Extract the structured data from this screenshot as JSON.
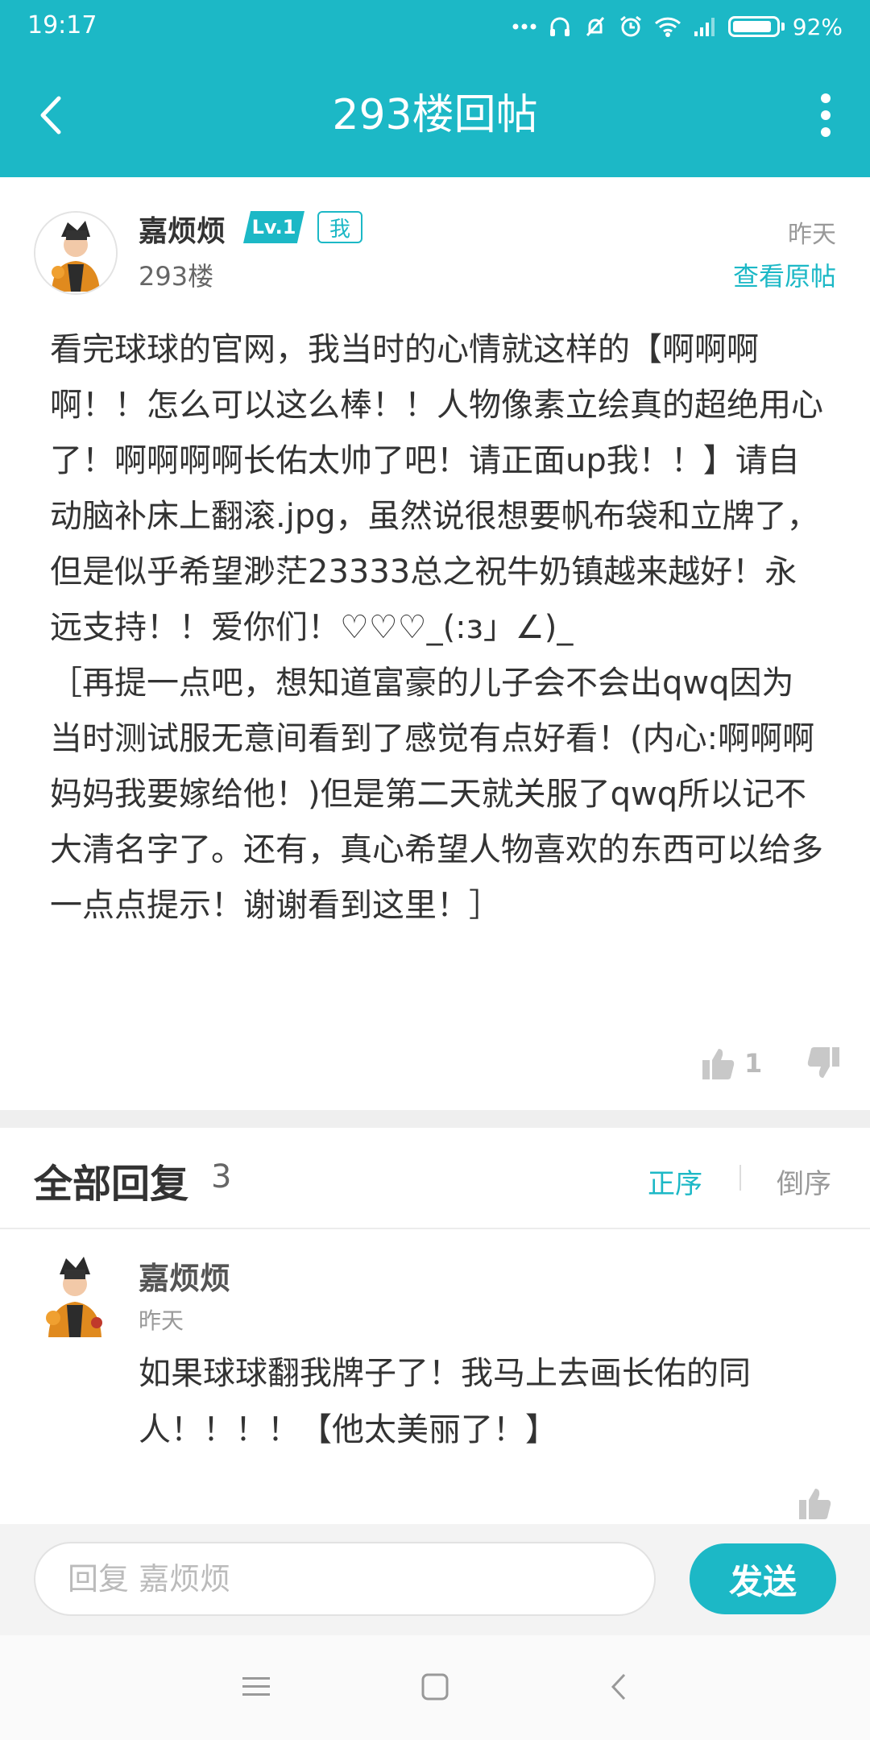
{
  "status_bar": {
    "time": "19:17",
    "battery_percent": "92%",
    "battery_level": 0.92
  },
  "app_bar": {
    "title": "293楼回帖"
  },
  "post": {
    "author": "嘉烦烦",
    "level_badge": "Lv.1",
    "me_badge": "我",
    "floor": "293楼",
    "time": "昨天",
    "view_original": "查看原帖",
    "body": "看完球球的官网，我当时的心情就这样的【啊啊啊啊！！怎么可以这么棒！！人物像素立绘真的超绝用心了！啊啊啊啊长佑太帅了吧！请正面up我！！】请自动脑补床上翻滚.jpg，虽然说很想要帆布袋和立牌了，但是似乎希望渺茫23333总之祝牛奶镇越来越好！永远支持！！爱你们！♡♡♡_(:з」∠)_\n［再提一点吧，想知道富豪的儿子会不会出qwq因为当时测试服无意间看到了感觉有点好看！(内心:啊啊啊妈妈我要嫁给他！)但是第二天就关服了qwq所以记不大清名字了。还有，真心希望人物喜欢的东西可以给多一点点提示！谢谢看到这里！］",
    "like_count": "1"
  },
  "replies": {
    "title": "全部回复",
    "count": "3",
    "sort_asc": "正序",
    "sort_desc": "倒序",
    "items": [
      {
        "author": "嘉烦烦",
        "time": "昨天",
        "text": "如果球球翻我牌子了！我马上去画长佑的同人！！！！【他太美丽了！】"
      }
    ]
  },
  "input_bar": {
    "placeholder": "回复 嘉烦烦",
    "send_label": "发送"
  },
  "colors": {
    "accent": "#1cb8c6",
    "text": "#333333",
    "muted": "#999999"
  },
  "icons": [
    "back-arrow-icon",
    "more-vertical-icon",
    "thumbs-up-icon",
    "thumbs-down-icon",
    "menu-icon",
    "home-icon",
    "back-nav-icon"
  ]
}
